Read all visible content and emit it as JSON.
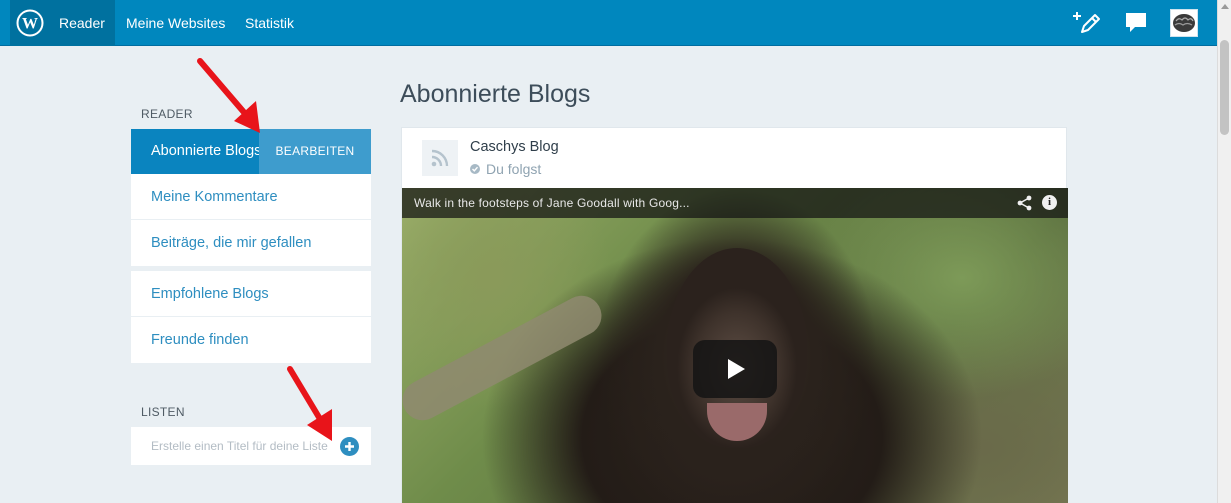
{
  "topbar": {
    "nav": {
      "reader": "Reader",
      "sites": "Meine Websites",
      "stats": "Statistik"
    }
  },
  "sidebar": {
    "reader_heading": "READER",
    "menu_group_1": [
      {
        "label": "Abonnierte Blogs",
        "active": true,
        "edit_label": "BEARBEITEN"
      },
      {
        "label": "Meine Kommentare"
      },
      {
        "label": "Beiträge, die mir gefallen"
      }
    ],
    "menu_group_2": [
      {
        "label": "Empfohlene Blogs"
      },
      {
        "label": "Freunde finden"
      }
    ],
    "lists_heading": "LISTEN",
    "list_input": {
      "placeholder": "Erstelle einen Titel für deine Liste",
      "value": ""
    }
  },
  "main": {
    "title": "Abonnierte Blogs",
    "post": {
      "blog_name": "Caschys Blog",
      "follow_status": "Du folgst",
      "video": {
        "title": "Walk in the footsteps of Jane Goodall with Goog..."
      }
    }
  },
  "colors": {
    "topbar": "#0087be",
    "active_item": "#0a84bf",
    "link": "#2e8ec0",
    "background": "#e9eff3",
    "annotation": "#e8141a"
  },
  "icons": [
    "wordpress-logo-icon",
    "write-post-icon",
    "notifications-icon",
    "avatar-icon",
    "rss-icon",
    "check-icon",
    "add-icon",
    "share-icon",
    "info-icon",
    "play-icon"
  ]
}
